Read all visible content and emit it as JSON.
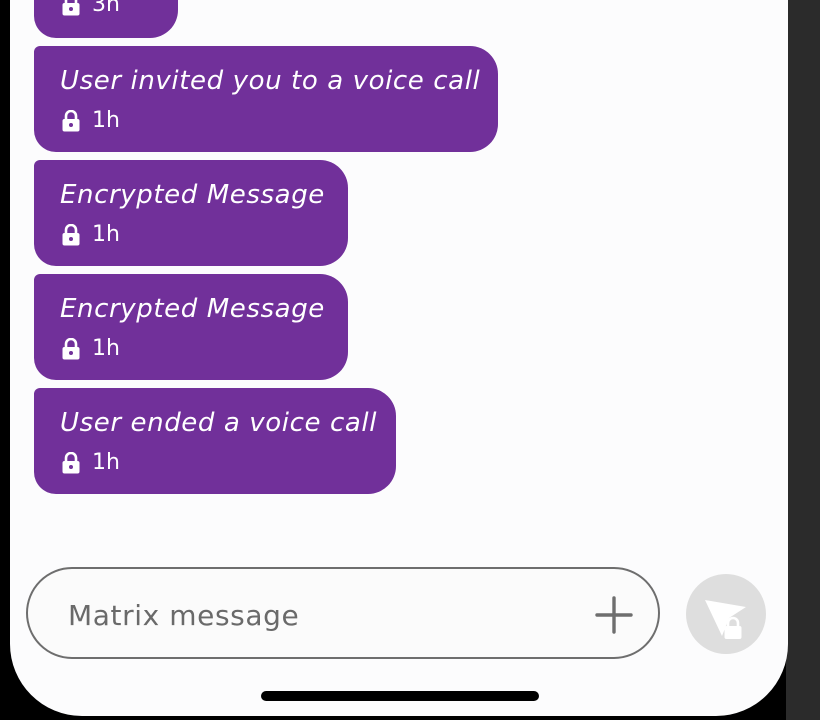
{
  "messages": [
    {
      "text": "",
      "time": "3h"
    },
    {
      "text": "User invited you to a voice call",
      "time": "1h"
    },
    {
      "text": "Encrypted Message",
      "time": "1h"
    },
    {
      "text": "Encrypted Message",
      "time": "1h"
    },
    {
      "text": "User ended a voice call",
      "time": "1h"
    }
  ],
  "composer": {
    "placeholder": "Matrix message"
  },
  "icons": {
    "lock": "lock-icon",
    "add": "plus-icon",
    "send": "send-encrypted-icon"
  },
  "colors": {
    "bubble": "#71309a",
    "bubble_text": "#ffffff",
    "background": "#fcfcfd",
    "send_button": "#dedede"
  }
}
